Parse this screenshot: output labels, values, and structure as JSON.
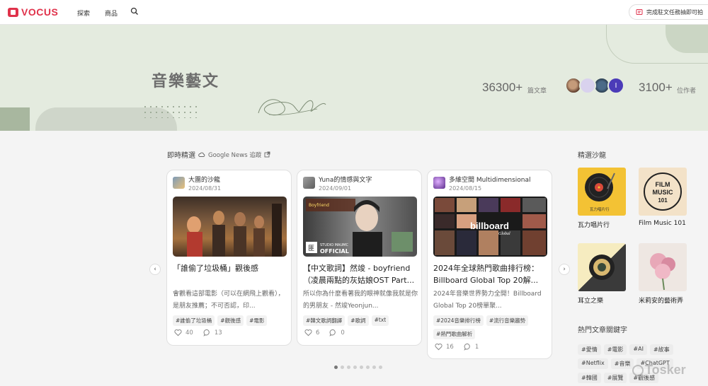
{
  "nav": {
    "logo": "VOCUS",
    "explore": "探索",
    "shop": "商品",
    "promo": "完成駐文任務抽即可拍"
  },
  "banner": {
    "title": "音樂藝文",
    "articles_count": "36300+",
    "articles_label": "篇文章",
    "authors_count": "3100+",
    "authors_label": "位作者",
    "last_avatar_initial": "I"
  },
  "section": {
    "title": "即時精選",
    "source": "Google News 追蹤"
  },
  "cards": [
    {
      "author": "大團的沙龍",
      "date": "2024/08/31",
      "title": "「誰偷了垃圾桶」觀後感",
      "excerpt": "會觀看這部電影（可以在網飛上觀看），是朋友推薦；不可否認，印...",
      "tags": [
        "#誰偷了垃圾桶",
        "#觀後感",
        "#電影"
      ],
      "likes": "40",
      "comments": "13"
    },
    {
      "author": "Yuna的情感與文字",
      "date": "2024/09/01",
      "title": "【中文歌詞】然竣 - boyfriend（凌晨兩點的灰姑娘OST Part...",
      "excerpt": "所以你為什麼看著我的眼神就像我就是你的男朋友 - 然竣Yeonjun...",
      "tags": [
        "#韓文歌詞翻譯",
        "#歌詞",
        "#txt"
      ],
      "likes": "6",
      "comments": "0",
      "image_text": [
        "STUDIO MAUMC",
        "OFFICIAL"
      ]
    },
    {
      "author": "多維空間 Multidimensional",
      "date": "2024/08/15",
      "title": "2024年全球熱門歌曲排行榜：Billboard Global Top 20解...",
      "excerpt": "2024年音樂世界勢力全開！Billboard Global Top 20榜單聚...",
      "tags": [
        "#2024音樂排行榜",
        "#流行音樂趨勢",
        "#熱門歌曲解析"
      ],
      "likes": "16",
      "comments": "1",
      "image_text": [
        "billboard",
        "Global"
      ]
    }
  ],
  "salons": {
    "title": "精選沙龍",
    "items": [
      {
        "name": "瓦力唱片行",
        "img_text": "瓦力唱片行"
      },
      {
        "name": "Film Music 101",
        "img_text": [
          "FILM",
          "MUSIC",
          "101"
        ]
      },
      {
        "name": "耳立之樂"
      },
      {
        "name": "米莉安的藝術弄"
      }
    ]
  },
  "keywords": {
    "title": "熱門文章關鍵字",
    "items": [
      "#愛情",
      "#電影",
      "#AI",
      "#故事",
      "#Netflix",
      "#音樂",
      "#ChatGPT",
      "#韓國",
      "#展覽",
      "#觀後感"
    ]
  },
  "pager": {
    "count": 8,
    "active": 0
  },
  "watermark": "Tosker"
}
